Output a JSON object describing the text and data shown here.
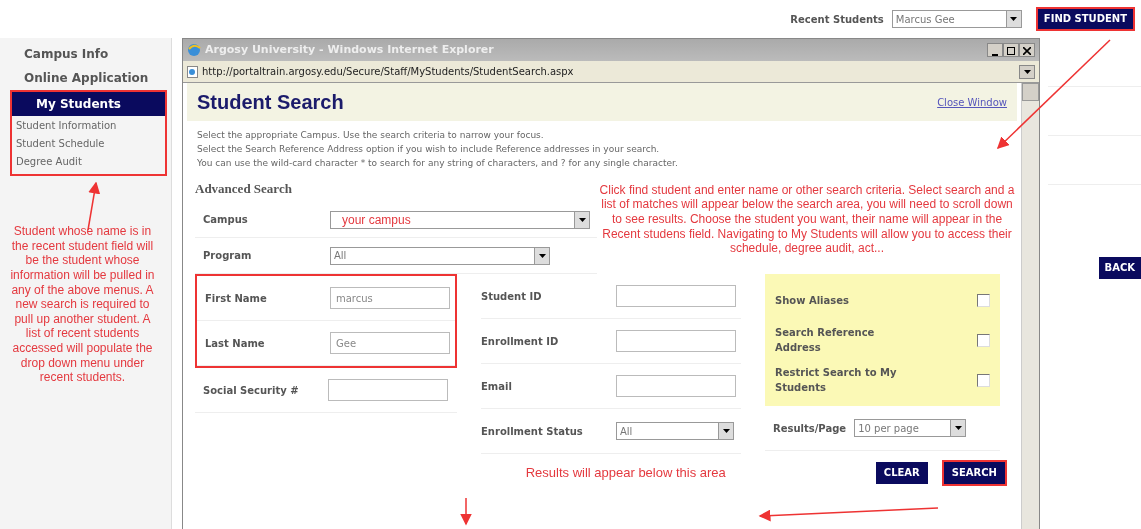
{
  "top_bar": {
    "recent_students_label": "Recent Students",
    "recent_students_value": "Marcus Gee",
    "find_button": "FIND STUDENT"
  },
  "sidebar": {
    "items": [
      {
        "label": "Campus Info",
        "selected": false
      },
      {
        "label": "Online Application",
        "selected": false
      },
      {
        "label": "My Students",
        "selected": true,
        "children": [
          {
            "label": "Student Information"
          },
          {
            "label": "Student Schedule"
          },
          {
            "label": "Degree Audit"
          }
        ]
      }
    ]
  },
  "popup": {
    "title": "Argosy University - Windows Internet Explorer",
    "url": "http://portaltrain.argosy.edu/Secure/Staff/MyStudents/StudentSearch.aspx",
    "heading": "Student Search",
    "close_link": "Close Window",
    "instructions": [
      "Select the appropriate Campus. Use the search criteria to narrow your focus.",
      "Select the Search Reference Address option if you wish to include Reference addresses in your search.",
      "You can use the wild-card character * to search for any string of characters, and ? for any single character."
    ],
    "section_title": "Advanced Search",
    "campus": {
      "label": "Campus",
      "value": "your campus"
    },
    "program": {
      "label": "Program",
      "value": "All"
    },
    "column_1": [
      {
        "label": "First Name",
        "value": "marcus"
      },
      {
        "label": "Last Name",
        "value": "Gee"
      },
      {
        "label": "Social Security #"
      }
    ],
    "column_2": [
      {
        "label": "Student ID"
      },
      {
        "label": "Enrollment ID"
      },
      {
        "label": "Email"
      }
    ],
    "enrollment_status": {
      "label": "Enrollment Status",
      "value": "All"
    },
    "options": [
      {
        "label": "Show Aliases",
        "checked": false
      },
      {
        "label": "Search Reference Address",
        "checked": false
      },
      {
        "label": "Restrict Search to My Students",
        "checked": false
      }
    ],
    "results_per_page": {
      "label": "Results/Page",
      "value": "10 per page"
    },
    "buttons": [
      "CLEAR",
      "SEARCH"
    ]
  },
  "back_button": "BACK",
  "annotations": {
    "sidebar_note": "Student whose name is in the recent student field will be the student whose information will be pulled in any of the above menus.  A new search is required to pull up another student.  A list of recent students accessed will populate the drop down menu under recent students.",
    "search_note": "Click find student and enter name or other search criteria. Select search and a list of matches will appear below the search area, you will need to scroll down to see results. Choose the student you want, their name will appear in the Recent studens field.  Navigating to My Students will allow you to access their schedule, degree audit, act...",
    "results_note": "Results will appear below this area"
  }
}
